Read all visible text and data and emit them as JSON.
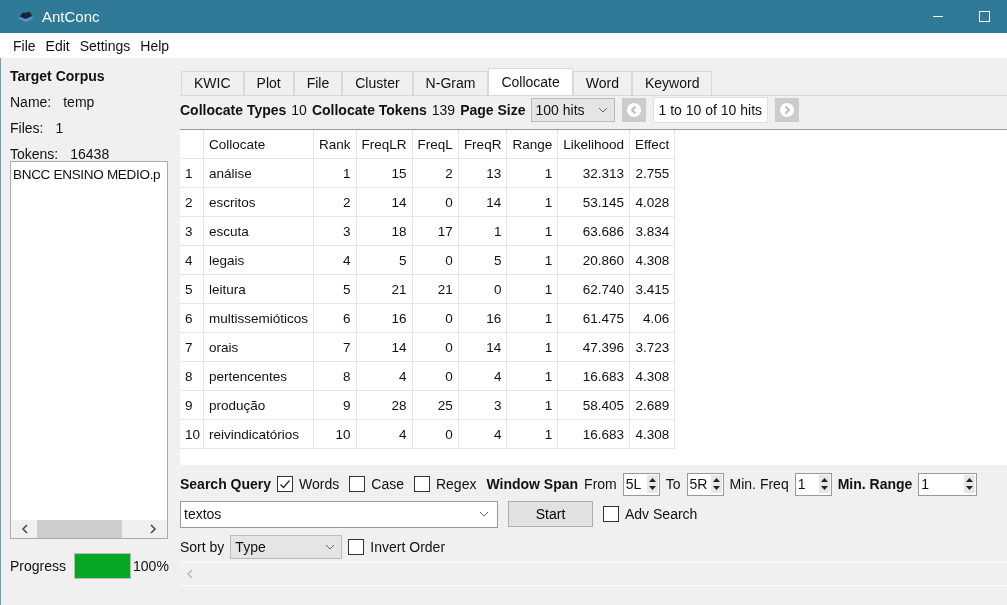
{
  "window": {
    "title": "AntConc"
  },
  "menu": [
    "File",
    "Edit",
    "Settings",
    "Help"
  ],
  "sidebar": {
    "heading": "Target Corpus",
    "fields": [
      {
        "label": "Name:",
        "value": "temp"
      },
      {
        "label": "Files:",
        "value": "1"
      },
      {
        "label": "Tokens:",
        "value": "16438"
      }
    ],
    "files": [
      "BNCC ENSINO MEDIO.p"
    ],
    "progress": {
      "label": "Progress",
      "level": 1,
      "reading": "100%"
    }
  },
  "tabs": [
    {
      "label": "KWIC",
      "selected": false
    },
    {
      "label": "Plot",
      "selected": false
    },
    {
      "label": "File",
      "selected": false
    },
    {
      "label": "Cluster",
      "selected": false
    },
    {
      "label": "N-Gram",
      "selected": false
    },
    {
      "label": "Collocate",
      "selected": true
    },
    {
      "label": "Word",
      "selected": false
    },
    {
      "label": "Keyword",
      "selected": false
    }
  ],
  "summary": {
    "types_label": "Collocate Types",
    "types_value": "10",
    "tokens_label": "Collocate Tokens",
    "tokens_value": "139",
    "page_size_label": "Page Size",
    "page_size": "100 hits",
    "hits": "1 to 10 of 10 hits"
  },
  "table": {
    "columns": [
      "",
      "Collocate",
      "Rank",
      "FreqLR",
      "FreqL",
      "FreqR",
      "Range",
      "Likelihood",
      "Effect"
    ],
    "rows": [
      [
        "1",
        "análise",
        "1",
        "15",
        "2",
        "13",
        "1",
        "32.313",
        "2.755"
      ],
      [
        "2",
        "escritos",
        "2",
        "14",
        "0",
        "14",
        "1",
        "53.145",
        "4.028"
      ],
      [
        "3",
        "escuta",
        "3",
        "18",
        "17",
        "1",
        "1",
        "63.686",
        "3.834"
      ],
      [
        "4",
        "legais",
        "4",
        "5",
        "0",
        "5",
        "1",
        "20.860",
        "4.308"
      ],
      [
        "5",
        "leitura",
        "5",
        "21",
        "21",
        "0",
        "1",
        "62.740",
        "3.415"
      ],
      [
        "6",
        "multissemióticos",
        "6",
        "16",
        "0",
        "16",
        "1",
        "61.475",
        "4.06"
      ],
      [
        "7",
        "orais",
        "7",
        "14",
        "0",
        "14",
        "1",
        "47.396",
        "3.723"
      ],
      [
        "8",
        "pertencentes",
        "8",
        "4",
        "0",
        "4",
        "1",
        "16.683",
        "4.308"
      ],
      [
        "9",
        "produção",
        "9",
        "28",
        "25",
        "3",
        "1",
        "58.405",
        "2.689"
      ],
      [
        "10",
        "reivindicatórios",
        "10",
        "4",
        "0",
        "4",
        "1",
        "16.683",
        "4.308"
      ]
    ]
  },
  "search": {
    "label": "Search Query",
    "options": [
      {
        "label": "Words",
        "checked": true
      },
      {
        "label": "Case",
        "checked": false
      },
      {
        "label": "Regex",
        "checked": false
      }
    ],
    "window_span_label": "Window Span",
    "from_label": "From",
    "from_value": "5L",
    "to_label": "To",
    "to_value": "5R",
    "min_freq_label": "Min. Freq",
    "min_freq_value": "1",
    "min_range_label": "Min. Range",
    "min_range_value": "1",
    "query": "textos",
    "start_label": "Start",
    "adv_search": {
      "label": "Adv Search",
      "checked": false
    },
    "sort_by_label": "Sort by",
    "sort_by_value": "Type",
    "invert_order": {
      "label": "Invert Order",
      "checked": false
    }
  }
}
